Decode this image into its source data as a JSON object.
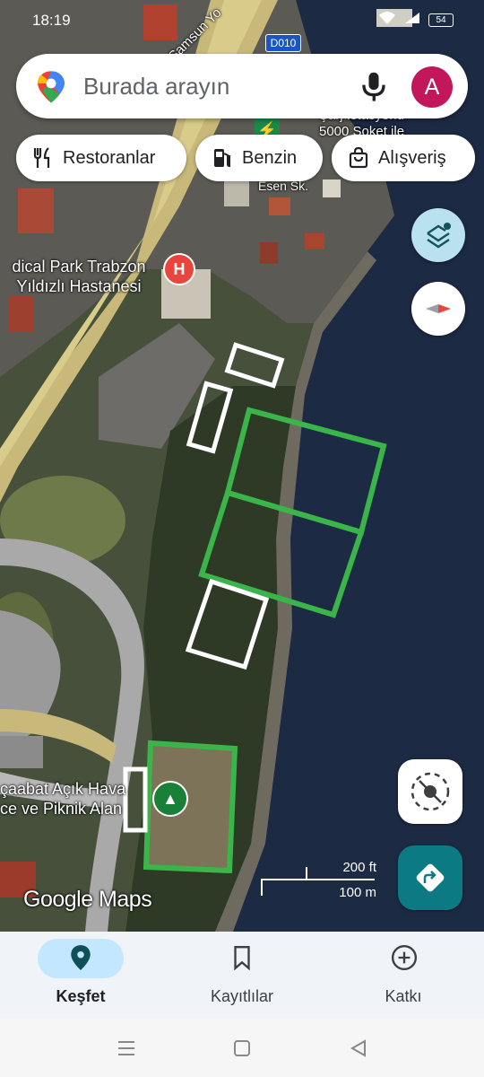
{
  "status_bar": {
    "time": "18:19",
    "battery": "54"
  },
  "search": {
    "placeholder": "Burada arayın",
    "avatar_letter": "A"
  },
  "chips": [
    {
      "label": "Restoranlar",
      "icon": "restaurant-icon"
    },
    {
      "label": "Benzin",
      "icon": "gas-station-icon"
    },
    {
      "label": "Alışveriş",
      "icon": "shopping-bag-icon"
    }
  ],
  "map": {
    "road_labels": {
      "samsun": "Samsun Yo",
      "route": "D010",
      "street": "Esen Sk."
    },
    "ev_station": {
      "line1": "Şarj İstasyonu",
      "line2": "5000 Soket ile"
    },
    "hospital": {
      "line1": "dical Park Trabzon",
      "line2": "Yıldızlı Hastanesi"
    },
    "park": {
      "line1": "çaabat Açık Hava",
      "line2": "ce ve Piknik Alan"
    },
    "scale": {
      "feet": "200 ft",
      "meters": "100 m"
    },
    "brand": "Google Maps"
  },
  "colors": {
    "accent_green": "#39b54a",
    "brand_red": "#c2185b",
    "nav_active": "#c2e7ff",
    "teal": "#0b7a82"
  },
  "bottom_nav": [
    {
      "label": "Keşfet",
      "icon": "location-pin-icon",
      "active": true
    },
    {
      "label": "Kayıtlılar",
      "icon": "bookmark-icon",
      "active": false
    },
    {
      "label": "Katkı",
      "icon": "add-circle-icon",
      "active": false
    }
  ]
}
